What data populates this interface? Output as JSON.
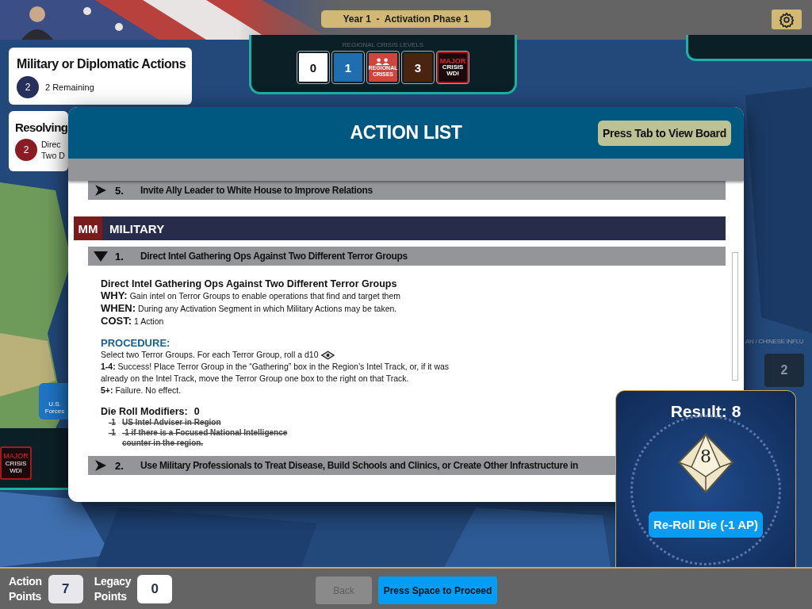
{
  "top_bar": {
    "phase": "Year 1  -  Activation Phase 1"
  },
  "action_cards": [
    {
      "title": "Military or Diplomatic Actions",
      "count": "2",
      "color": "#27305a",
      "lines": [
        "2 Remaining"
      ]
    },
    {
      "title": "Resolving",
      "count": "2",
      "color": "#8a1c24",
      "lines": [
        "Direc",
        "Two D"
      ]
    }
  ],
  "crisis_levels": {
    "caption": "REGIONAL CRISIS LEVELS",
    "tiles": [
      {
        "kind": "number",
        "label": "0",
        "color": "#ffffff"
      },
      {
        "kind": "number",
        "label": "1",
        "color": "#1f6fb0"
      },
      {
        "kind": "regional",
        "lines": [
          "REGIONAL",
          "CRISES"
        ],
        "color": "#d0443c"
      },
      {
        "kind": "number",
        "label": "3",
        "color": "#4a2410"
      },
      {
        "kind": "major",
        "lines": [
          "MAJOR",
          "CRISIS",
          "WDI"
        ],
        "color": "#1a0a0c"
      }
    ]
  },
  "map": {
    "forces_badge": [
      "U.S.",
      "Forces"
    ],
    "major_tile": [
      "MAJOR",
      "CRISIS",
      "WDI"
    ],
    "influence_caption": "AN / CHINESE INFLU",
    "influence_value": "2"
  },
  "action_list": {
    "title": "ACTION LIST",
    "view_board_button": "Press Tab to View Board",
    "rows": [
      {
        "kind": "item",
        "number": "5.",
        "title": "Invite Ally Leader to White House to Improve Relations",
        "expanded": false
      },
      {
        "kind": "section",
        "code": "MM",
        "title": "MILITARY"
      },
      {
        "kind": "item",
        "number": "1.",
        "title": "Direct Intel Gathering Ops Against Two Different Terror Groups",
        "expanded": true,
        "detail": {
          "heading": "Direct Intel Gathering Ops Against Two Different Terror Groups",
          "fields": [
            {
              "label": "WHY:",
              "text": "Gain intel on Terror Groups to enable operations that find and target them"
            },
            {
              "label": "WHEN:",
              "text": "During any Activation Segment in which Military Actions may be taken."
            },
            {
              "label": "COST:",
              "text": "1 Action"
            }
          ],
          "procedure_title": "PROCEDURE:",
          "procedure": [
            {
              "kind": "roll",
              "text": "Select two Terror Groups. For each Terror Group, roll a d10"
            },
            {
              "kind": "plain",
              "text": "**1-4:** Success! Place Terror Group in the “Gathering” box in the Region’s Intel Track, or, if it was already on the Intel Track, move the Terror Group one box to the right on that Track."
            },
            {
              "kind": "plain",
              "text": "**5+:** Failure. No effect."
            }
          ],
          "modifiers_label": "Die Roll Modifiers:",
          "modifiers_total": "0",
          "modifiers": [
            {
              "value": "-1",
              "text": "US Intel Adviser in Region",
              "struck": true
            },
            {
              "value": "-1",
              "text": "-1 if there is a Focused National Intelligence counter in the region.",
              "struck": true
            }
          ]
        }
      },
      {
        "kind": "item",
        "number": "2.",
        "title": "Use Military Professionals to Treat Disease, Build Schools and Clinics, or Create Other Infrastructure in",
        "expanded": false
      }
    ]
  },
  "result": {
    "title": "Result: 8",
    "die_value": "8",
    "reroll_button": "Re-Roll Die (-1 AP)"
  },
  "bottom_bar": {
    "counters": [
      {
        "label": [
          "Action",
          "Points"
        ],
        "value": "7",
        "selected": true
      },
      {
        "label": [
          "Legacy",
          "Points"
        ],
        "value": "0",
        "selected": false
      }
    ],
    "back_button": {
      "label": "Back",
      "disabled": true
    },
    "proceed_button": "Press Space to Proceed"
  }
}
